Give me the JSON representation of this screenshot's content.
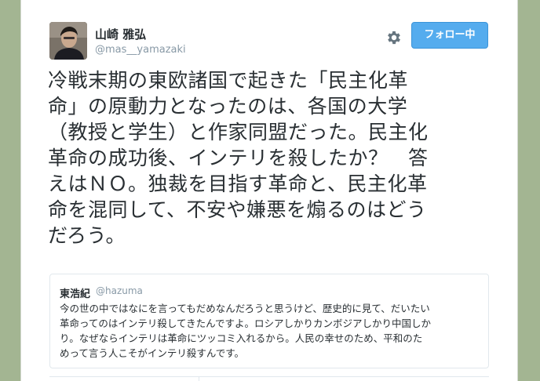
{
  "tweet": {
    "author": {
      "display_name": "山崎 雅弘",
      "handle": "@mas__yamazaki",
      "avatar_icon": "user-photo"
    },
    "follow_button_label": "フォロー中",
    "settings_icon": "gear-icon",
    "text_lines": [
      "冷戦末期の東欧諸国で起きた「民主化革",
      "命」の原動力となったのは、各国の大学",
      "（教授と学生）と作家同盟だった。民主化",
      "革命の成功後、インテリを殺したか？　答",
      "えはＮＯ。独裁を目指す革命と、民主化革",
      "命を混同して、不安や嫌悪を煽るのはどう",
      "だろう。"
    ]
  },
  "quoted_tweet": {
    "author_name": "東浩紀",
    "author_handle": "@hazuma",
    "text_lines": [
      "今の世の中ではなにを言ってもだめなんだろうと思うけど、歴史的に見て、だいたい",
      "革命ってのはインテリ殺してきたんですよ。ロシアしかりカンボジアしかり中国しか",
      "り。なぜならインテリは革命にツッコミ入れるから。人民の幸せのため、平和のた",
      "めって言う人こそがインテリ殺すんです。"
    ]
  },
  "colors": {
    "background": "#a3b592",
    "follow_button": "#55acee",
    "text": "#292f33",
    "muted": "#8899a6"
  }
}
